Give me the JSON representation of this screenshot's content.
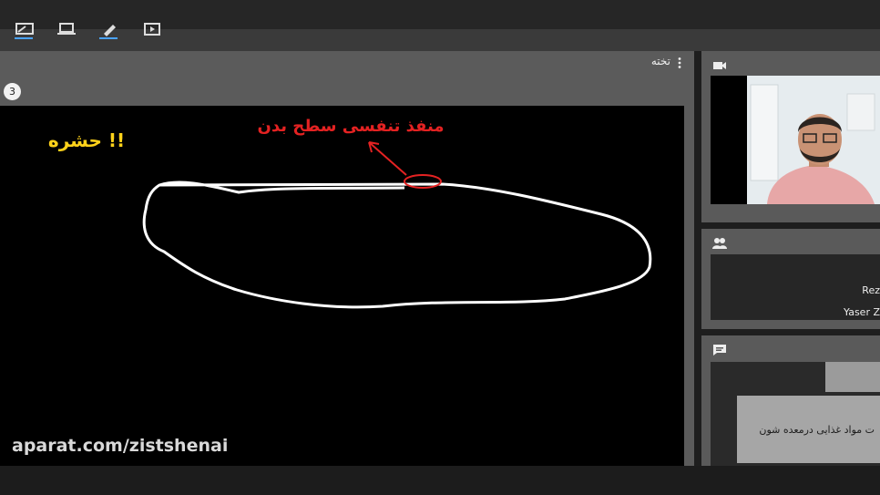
{
  "toolbar": {
    "tools": [
      {
        "name": "pen-tool-icon",
        "active": true
      },
      {
        "name": "laptop-icon",
        "active": false
      },
      {
        "name": "marker-tool-icon",
        "active": true
      },
      {
        "name": "slide-icon",
        "active": false
      }
    ],
    "accent": "#4aa3ff"
  },
  "board": {
    "title": "تخته",
    "page_number": "3",
    "drawing_title": "!! حشره",
    "annotation": "منفذ تنفسی سطح بدن",
    "colors": {
      "title": "#ffd21a",
      "annotation": "#e42222",
      "outline": "#ffffff"
    }
  },
  "watermark": "aparat.com/zistshenai",
  "video_panel": {
    "icon": "video-camera-icon"
  },
  "people_panel": {
    "icon": "people-icon",
    "participants": [
      "Rez",
      "Yaser Z"
    ]
  },
  "chat_panel": {
    "icon": "chat-icon",
    "message": "ت مواد غذایی درمعده شون"
  }
}
